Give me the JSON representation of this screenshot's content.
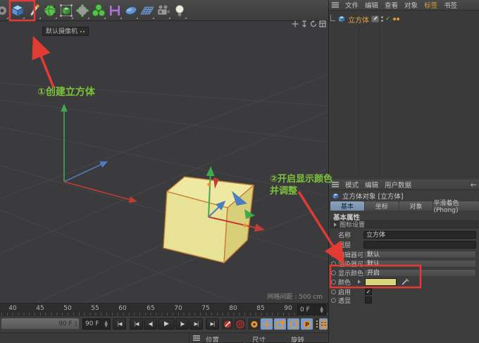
{
  "colors": {
    "highlight_red": "#E23B33",
    "annotation_green": "#7CC13C",
    "object_name_orange": "#E8A33F",
    "active_tool_blue": "#7A9CC8",
    "axis_x": "#C43B33",
    "axis_y": "#3FA94C",
    "axis_z": "#4A7EC0"
  },
  "toolbar": {
    "icons": [
      "gear-icon",
      "cube-primitive-icon",
      "pen-spline-icon",
      "subdivision-surface-icon",
      "generator-cube-icon",
      "deformer-sphere-icon",
      "mograph-cloner-icon",
      "spline-helper-icon",
      "floor-disc-icon",
      "environment-grid-icon",
      "camera-icon",
      "light-icon"
    ],
    "highlighted_icon": "cube-primitive-icon"
  },
  "viewport": {
    "camera_label": "默认摄像机",
    "grid_spacing_label": "网格间距 : 500 cm",
    "annotations": {
      "step1": "①创建立方体",
      "step2_line1": "②开启显示颜色",
      "step2_line2": "并调整"
    },
    "cube_colors": {
      "top": "#EDE8A2",
      "left": "#E7E295",
      "right": "#D9CF78",
      "outline": "#C67E33"
    }
  },
  "timeline": {
    "ticks": [
      "40",
      "45",
      "50",
      "55",
      "60",
      "65",
      "70",
      "75",
      "80",
      "85",
      "90"
    ],
    "range_label": "90 F",
    "range_grip": "||",
    "end_field": "90 F",
    "current_field": "0 F"
  },
  "transport": {
    "buttons": [
      {
        "name": "jump-start",
        "glyph": "|◀"
      },
      {
        "name": "prev-key",
        "glyph": "|◀"
      },
      {
        "name": "prev-frame",
        "glyph": "◀|"
      },
      {
        "name": "play",
        "glyph": "▶"
      },
      {
        "name": "next-frame",
        "glyph": "|▶"
      },
      {
        "name": "next-key",
        "glyph": "▶|"
      },
      {
        "name": "jump-end",
        "glyph": "▶|"
      }
    ],
    "record_buttons": [
      {
        "name": "record-active-objects",
        "active": false
      },
      {
        "name": "autokeying",
        "active": false
      },
      {
        "name": "keyframe-selection",
        "active": false
      },
      {
        "name": "record-position",
        "active": true
      },
      {
        "name": "record-scale",
        "active": true
      },
      {
        "name": "record-rotation",
        "active": true
      },
      {
        "name": "record-parameter",
        "active": true
      },
      {
        "name": "record-pla",
        "active": false
      },
      {
        "name": "film-strip",
        "active": true
      }
    ]
  },
  "coordinate_manager": {
    "headers": [
      "位置",
      "尺寸",
      "旋转"
    ]
  },
  "object_manager": {
    "menu": [
      "文件",
      "编辑",
      "查看",
      "对象",
      "标签",
      "书签"
    ],
    "active_menu": "标签",
    "objects": [
      {
        "name": "立方体",
        "enabled_check": "✓"
      }
    ]
  },
  "attributes": {
    "menu": [
      "模式",
      "编辑",
      "用户数据"
    ],
    "back_glyph": "←",
    "title": "立方体对象 [立方体]",
    "tabs": [
      "基本",
      "坐标",
      "对象",
      "平滑着色(Phong)"
    ],
    "active_tab": "基本",
    "section_title": "基本属性",
    "icon_settings": "图标设置",
    "name_label": "名称",
    "name_value": "立方体",
    "layer_label": "图层",
    "layer_value": "",
    "editor_visible_label": "编辑器可见",
    "editor_visible_value": "默认",
    "renderer_visible_label": "渲染器可见",
    "renderer_visible_value": "默认",
    "display_color_label": "显示颜色",
    "display_color_value": "开启",
    "color_label": "颜色",
    "color_hex": "#D9D47B",
    "enabled_label": "启用",
    "enabled_check": "✓",
    "xray_label": "透显",
    "xray_check": ""
  }
}
